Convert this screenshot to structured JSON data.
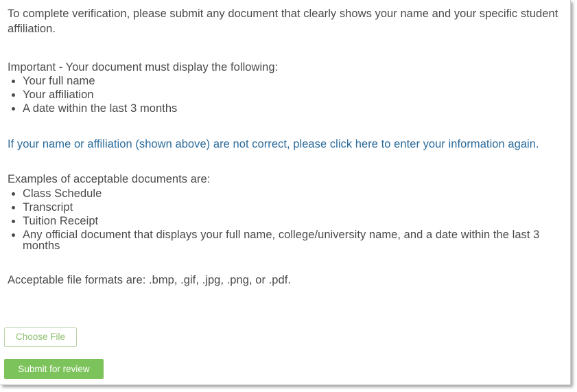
{
  "instructions": {
    "intro": "To complete verification, please submit any document that clearly shows your name and your specific student affiliation.",
    "important_heading": "Important - Your document must display the following:",
    "requirements": [
      "Your full name",
      "Your affiliation",
      "A date within the last 3 months"
    ],
    "correction_link": "If your name or affiliation (shown above) are not correct, please click here to enter your information again.",
    "examples_heading": "Examples of acceptable documents are:",
    "examples": [
      "Class Schedule",
      "Transcript",
      "Tuition Receipt",
      "Any official document that displays your full name, college/university name, and a date within the last 3 months"
    ],
    "formats": "Acceptable file formats are: .bmp, .gif, .jpg, .png, or .pdf."
  },
  "upload": {
    "choose_file_label": "Choose File",
    "submit_label": "Submit for review"
  },
  "colors": {
    "text": "#4a4a4a",
    "link": "#2b6b9c",
    "accent_green": "#7dc35b",
    "choose_file_text": "#8cbf6e"
  }
}
